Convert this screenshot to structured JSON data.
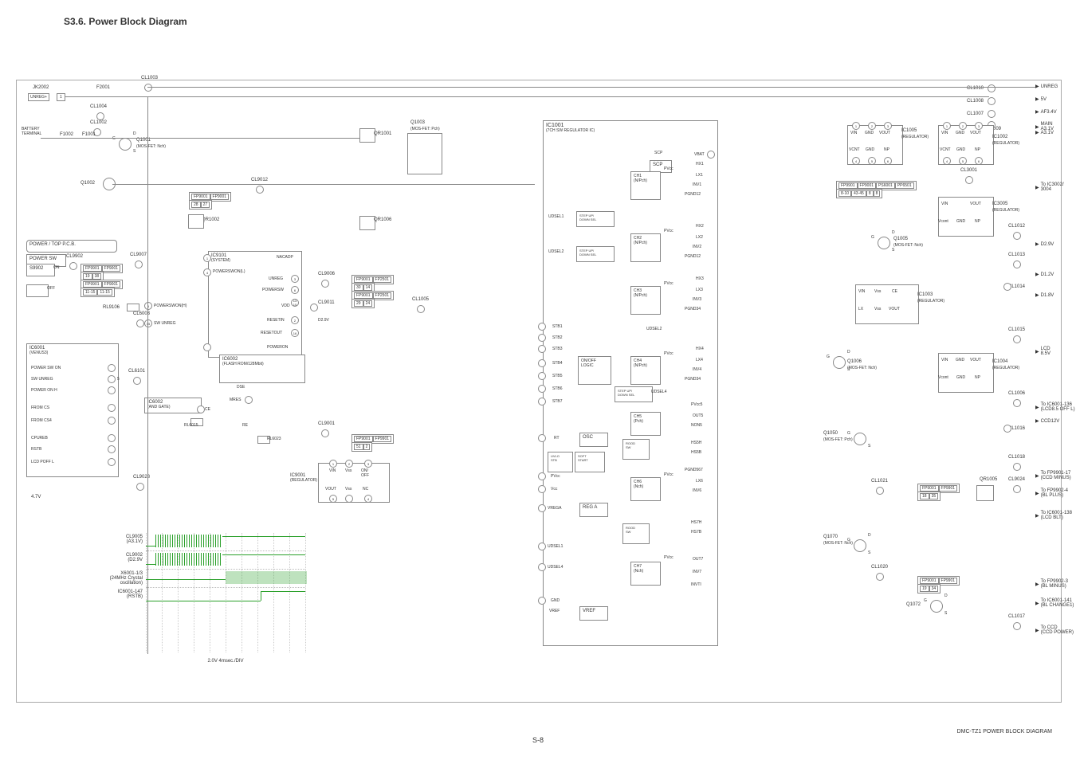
{
  "section_title": "S3.6. Power Block Diagram",
  "page_number": "S-8",
  "doc_footer": "DMC-TZ1 POWER BLOCK DIAGRAM",
  "labels": {
    "jk2002": "JK2002",
    "unreg_plus": "UNREG+",
    "pin1": "1",
    "f2001": "F2001",
    "cl1003": "CL1003",
    "cl1004": "CL1004",
    "cl1002": "CL1002",
    "battery_terminal": "BATTERY\nTERMINAL",
    "f1002": "F1002",
    "f1001": "F1001",
    "q1001": "Q1001",
    "q1001_sub": "(MOS-FET: Nch)",
    "g": "G",
    "d": "D",
    "s": "S",
    "q1002": "Q1002",
    "cl9012": "CL9012",
    "fp9001": "FP9001",
    "fp9001b": "FP9001",
    "p28": "28",
    "p27": "27",
    "qr1002": "QR1002",
    "power_top_pcb": "POWER / TOP P.C.B.",
    "power_sw": "POWER SW",
    "s9902": "S9902",
    "on": "ON",
    "off": "OFF",
    "cl9902": "CL9902",
    "fp9901": "FP9901",
    "fp9001c": "FP9001",
    "p19a": "19",
    "p38": "38",
    "fp9901b": "FP9901",
    "fp9001d": "FP9001",
    "p15": "15",
    "p11_19": "11-15",
    "p11_15": "11-15",
    "cl9007": "CL9007",
    "ic9101": "IC9101",
    "ic9101_sub": "(SYSTEM)",
    "nacadp": "NACADP",
    "powerswon_l": "POWERSWON(L)",
    "rl9106": "RL9106",
    "powerswon_h": "POWERSWON(H)",
    "cl6003": "CL6003",
    "sw_unreg": "SW UNREG",
    "unreg_port": "UNREG",
    "powersw": "POWERSW",
    "resetin": "RESETIN",
    "resetout": "RESETOUT",
    "poweron": "POWERON",
    "vdd": "VDD",
    "d29v": "D2.9V",
    "cl9006": "CL9006",
    "fp9001e": "FP9001",
    "fp2501": "FP2501",
    "p30": "30",
    "p14": "14",
    "fp9001f": "FP9001",
    "fp2501b": "FP2501",
    "p29": "29",
    "p24": "24",
    "cl9011": "CL9011",
    "ic6001": "IC6001",
    "ic6001_sub": "(VENUS3)",
    "power_sw_on": "POWER SW ON",
    "sw_unreg_h": "SW UNREG",
    "power_on_h": "POWER ON H",
    "p5": "5",
    "cl6101": "CL6101",
    "ic6002": "IC6002",
    "ic6002_sub": "(FLASH ROM/128Mbit)",
    "dse": "DSE",
    "ic6002b": "IC6002",
    "and_gate": "(AND GATE)",
    "ce": "CE",
    "mres": "MRES",
    "re": "RE",
    "rl6015": "RL6015",
    "rl6023": "RL6023",
    "from_cs": "FROM CS",
    "from_cs4": "FROM CS4",
    "cpureb": "CPUREB",
    "rstb": "RSTB",
    "lcd_poff_l": "LCD POFF L",
    "cl9028": "CL9028",
    "v47": "4.7V",
    "cl9001": "CL9001",
    "fp9001g": "FP9001",
    "fp9901c": "FP9901",
    "p51": "51",
    "p2": "2",
    "ic9001": "IC9001",
    "ic9001_sub": "(REGULATOR)",
    "vin": "VIN",
    "vss": "Vss",
    "onoff": "ON/\nOFF",
    "vout": "VOUT",
    "nc": "NC",
    "qr1001": "QR1001",
    "q1003": "Q1003",
    "q1003_sub": "(MOS-FET: Pch)",
    "qr1006": "QR1006",
    "cl1005": "CL1005",
    "ic1001": "IC1001",
    "ic1001_sub": "(7CH SW REGULATOR IC)",
    "scp": "SCP",
    "vbat": "VBAT",
    "pvcc": "PVcc",
    "hx1": "HX1",
    "lx1": "LX1",
    "inv1": "INV1",
    "pgnd12": "PGND12",
    "ch1": "CH1",
    "npch": "(N/Pch)",
    "udsel1": "UDSEL1",
    "step_up_down_sel": "STEP UP/\nDOWN SEL",
    "hx2": "HX2",
    "lx2": "LX2",
    "inv2": "INV2",
    "pgnd12b": "PGND12",
    "ch2": "CH2",
    "udsel2": "UDSEL2",
    "hx3": "HX3",
    "lx3": "LX3",
    "inv3": "INV3",
    "pgnd34": "PGND34",
    "ch3": "CH3",
    "stb1": "STB1",
    "stb2": "STB2",
    "stb3": "STB3",
    "stb4": "STB4",
    "stb5": "STB5",
    "stb6": "STB6",
    "stb7": "STB7",
    "onoff_logic": "ON/OFF\nLOGIC",
    "udsel2b": "UDSEL2",
    "hx4": "HX4",
    "lx4": "LX4",
    "inv4": "INV4",
    "pgnd34b": "PGND34",
    "ch4": "CH4",
    "udsel4": "UDSEL4",
    "ch5": "CH5",
    "pch": "(Pch)",
    "out5": "OUT5",
    "non5": "NON5",
    "pvcc5": "PVcc5",
    "rt": "RT",
    "osc": "OSC",
    "uvlo_stb": "UVLO\nSTB",
    "soft_start": "SOFT\nSTART",
    "rood_sw": "ROOD\nSW",
    "hs5h": "HS5H",
    "hs5b": "HS5B",
    "pgnd567": "PGND567",
    "lx6": "LX6",
    "inv6": "INV6",
    "ch6": "CH6",
    "nch": "(Nch)",
    "vcc": "Vcc",
    "vrega": "VREGA",
    "reg_a": "REG A",
    "hs7h": "HS7H",
    "hs7b": "HS7B",
    "udsel1b": "UDSEL1",
    "udsel4b": "UDSEL4",
    "ch7": "CH7",
    "out7": "OUT7",
    "inv7": "INV7",
    "invti": "INVTI",
    "gnd": "GND",
    "vref": "VREF",
    "ic1005": "IC1005",
    "ic1005_sub": "(REGULATOR)",
    "cl1009": "CL1009",
    "ic1002": "IC1002",
    "ic1002_sub": "(REGULATOR)",
    "vcnt": "VCNT",
    "np": "NP",
    "g2": "G",
    "d2": "D",
    "s2": "S",
    "cl3001": "CL3001",
    "fp9901d": "FP9901",
    "fp9001h": "FP9001",
    "ps6001": "PS6001",
    "pp6501": "PP6501",
    "p8_10": "8-10",
    "p43_45": "43-45",
    "p8": "8",
    "p8b": "8",
    "ic3002_3004": "To IC3002/\n3004",
    "ic3005": "IC3005",
    "ic3005_sub": "(REGULATOR)",
    "cl1012": "CL1012",
    "d29v_out": "D2.9V",
    "q1005": "Q1005",
    "q1005_sub": "(MOS-FET: Nch)",
    "cl1013": "CL1013",
    "d12v": "D1.2V",
    "cl1014": "CL1014",
    "d18v": "D1.8V",
    "ic1003": "IC1003",
    "ic1003_sub": "(REGULATOR)",
    "lx": "LX",
    "cl1015": "CL1015",
    "lcd_85v": "LCD 8.5V",
    "q1006": "Q1006",
    "q1006_sub": "(MOS-FET: Nch)",
    "ic1004": "IC1004",
    "ic1004_sub": "(REGULATOR)",
    "vcont": "Vcont",
    "cl1006": "CL1006",
    "to_ic6001_136": "To IC6001-136\n(LCD8.5 OFF L)",
    "ccd12v": "CCD12V",
    "cl1016": "CL1016",
    "q1050": "Q1050",
    "q1050_sub": "(MOS-FET: Pch)",
    "cl1018": "CL1018",
    "to_fp9901_17": "To FP9901-17\n(CCD MINUS)",
    "cl1021": "CL1021",
    "fp9001i": "FP9001",
    "fp9901e": "FP9901",
    "p18": "18",
    "p35": "35",
    "qr1005": "QR1005",
    "cl9024": "CL9024",
    "to_fp9902_4": "To FP9902-4\n(BL PLUS)",
    "to_ic6001_138": "To IC6001-138\n(LCD BLT)",
    "q1070": "Q1070",
    "q1070_sub": "(MOS-FET: Nch)",
    "cl1020": "CL1020",
    "fp9001j": "FP9001",
    "fp9901f": "FP9901",
    "p19": "19",
    "p34": "34",
    "to_fp9902_3": "To FP9902-3\n(BL MINUS)",
    "q1072": "Q1072",
    "to_ic6001_141": "To IC6001-141\n(BL CHANGE1)",
    "cl1017": "CL1017",
    "to_ccd": "To CCD\n(CCD POWER)",
    "out_unreg": "UNREG",
    "out_5v": "5V",
    "out_af34v": "AF3.4V",
    "out_main_a31v": "MAIN A3.1V",
    "out_a31v": "A3.1V",
    "cl1010": "CL1010",
    "cl1008": "CL1008",
    "cl1007": "CL1007"
  },
  "wave": {
    "rows": [
      "CL9005\n(A3.1V)",
      "CL9002\n(D2.9V",
      "X6001-1/3\n(24MHz Crystal\noscillation)",
      "IC6001-147\n(RSTB)"
    ],
    "caption": "2.0V 4msec./DIV"
  }
}
